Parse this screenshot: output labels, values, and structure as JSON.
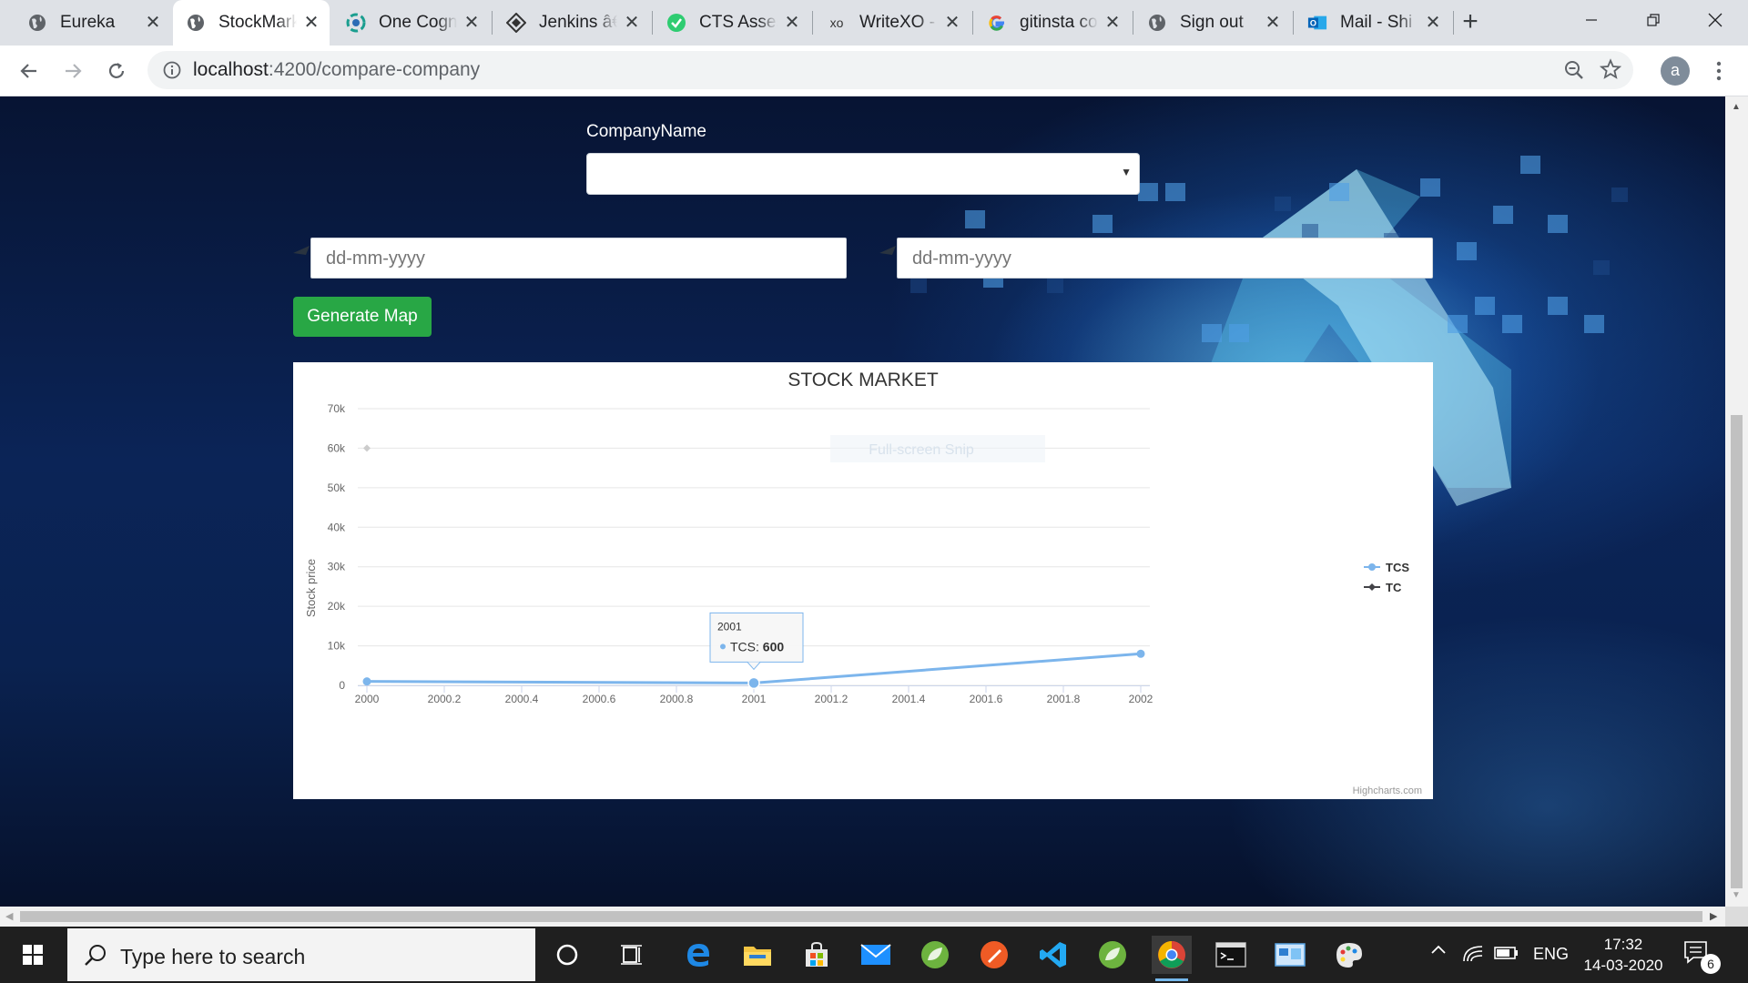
{
  "browser": {
    "tabs": [
      {
        "title": "Eureka",
        "icon": "globe-icon",
        "active": false
      },
      {
        "title": "StockMarket",
        "icon": "globe-icon",
        "active": true
      },
      {
        "title": "One Cognizant",
        "icon": "cognizant-icon",
        "active": false
      },
      {
        "title": "Jenkins â€“",
        "icon": "jenkins-icon",
        "active": false
      },
      {
        "title": "CTS Assessment",
        "icon": "check-circle-icon",
        "active": false
      },
      {
        "title": "WriteXO - ",
        "icon": "xo-icon",
        "active": false
      },
      {
        "title": "gitinsta com",
        "icon": "google-icon",
        "active": false
      },
      {
        "title": "Sign out",
        "icon": "globe-icon",
        "active": false
      },
      {
        "title": "Mail - Shi",
        "icon": "outlook-icon",
        "active": false
      }
    ],
    "xo_label": "xo",
    "new_tab": "+",
    "url_host": "localhost",
    "url_path": ":4200/compare-company",
    "avatar_letter": "a"
  },
  "form": {
    "company_label": "CompanyName",
    "company_value": "",
    "from_date_placeholder": "dd-mm-yyyy",
    "to_date_placeholder": "dd-mm-yyyy",
    "generate_label": "Generate Map"
  },
  "watermark": "Full-screen Snip",
  "chart_data": {
    "type": "line",
    "title": "STOCK MARKET",
    "ylabel": "Stock price",
    "xlabel": "",
    "xlim": [
      2000,
      2002
    ],
    "ylim": [
      0,
      70000
    ],
    "x_ticks": [
      2000,
      2000.2,
      2000.4,
      2000.6,
      2000.8,
      2001,
      2001.2,
      2001.4,
      2001.6,
      2001.8,
      2002
    ],
    "y_ticks": [
      0,
      10000,
      20000,
      30000,
      40000,
      50000,
      60000,
      70000
    ],
    "y_tick_labels": [
      "0",
      "10k",
      "20k",
      "30k",
      "40k",
      "50k",
      "60k",
      "70k"
    ],
    "series": [
      {
        "name": "TCS",
        "color": "#7cb5ec",
        "marker": "circle",
        "x": [
          2000,
          2001,
          2002
        ],
        "y": [
          1000,
          600,
          8000
        ]
      },
      {
        "name": "TC",
        "color": "#434348",
        "marker": "diamond",
        "x": [
          2000
        ],
        "y": [
          60000
        ]
      }
    ],
    "legend_position": "right",
    "tooltip": {
      "header": "2001",
      "series": "TCS",
      "value": "600"
    },
    "credits": "Highcharts.com"
  },
  "taskbar": {
    "search_placeholder": "Type here to search",
    "lang": "ENG",
    "time": "17:32",
    "date": "14-03-2020",
    "notification_count": "6"
  }
}
